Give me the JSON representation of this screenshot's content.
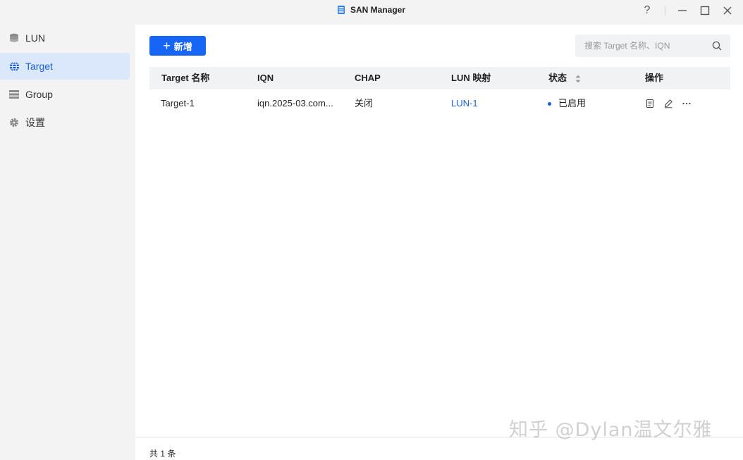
{
  "window": {
    "title": "SAN Manager",
    "help_label": "?"
  },
  "sidebar": {
    "items": [
      {
        "label": "LUN",
        "icon": "database-icon"
      },
      {
        "label": "Target",
        "icon": "globe-icon",
        "active": true
      },
      {
        "label": "Group",
        "icon": "list-icon"
      },
      {
        "label": "设置",
        "icon": "gear-icon"
      }
    ]
  },
  "toolbar": {
    "add_label": "新增",
    "search_placeholder": "搜索 Target 名称、IQN"
  },
  "table": {
    "columns": [
      "Target 名称",
      "IQN",
      "CHAP",
      "LUN 映射",
      "状态",
      "操作"
    ],
    "rows": [
      {
        "name": "Target-1",
        "iqn": "iqn.2025-03.com...",
        "chap": "关闭",
        "lun": "LUN-1",
        "status": "已启用"
      }
    ]
  },
  "footer": {
    "total_text": "共 1 条"
  },
  "watermark": "知乎 @Dylan温文尔雅",
  "colors": {
    "accent": "#1765f5",
    "link": "#1a5fd6",
    "active_nav_bg": "#dbe7fb"
  }
}
